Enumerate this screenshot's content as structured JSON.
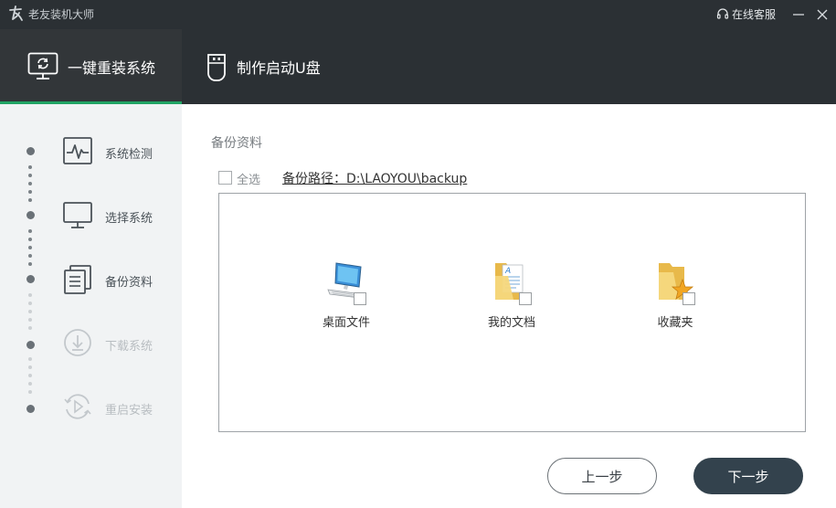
{
  "window": {
    "title": "老友装机大师",
    "service_label": "在线客服"
  },
  "header": {
    "tabs": [
      {
        "label": "一键重装系统",
        "icon": "monitor-refresh-icon",
        "active": true
      },
      {
        "label": "制作启动U盘",
        "icon": "usb-drive-icon",
        "active": false
      }
    ]
  },
  "sidebar": {
    "steps": [
      {
        "label": "系统检测",
        "icon": "pulse-monitor-icon",
        "state": "done"
      },
      {
        "label": "选择系统",
        "icon": "monitor-icon",
        "state": "done"
      },
      {
        "label": "备份资料",
        "icon": "documents-icon",
        "state": "current"
      },
      {
        "label": "下载系统",
        "icon": "download-icon",
        "state": "pending"
      },
      {
        "label": "重启安装",
        "icon": "restart-icon",
        "state": "pending"
      }
    ]
  },
  "main": {
    "section_title": "备份资料",
    "select_all_label": "全选",
    "backup_path": "备份路径：D:\\LAOYOU\\backup",
    "items": [
      {
        "label": "桌面文件",
        "icon": "desktop-computer-icon",
        "checked": false
      },
      {
        "label": "我的文档",
        "icon": "my-documents-folder-icon",
        "checked": false
      },
      {
        "label": "收藏夹",
        "icon": "favorites-folder-icon",
        "checked": false
      }
    ],
    "prev_button": "上一步",
    "next_button": "下一步"
  },
  "colors": {
    "titlebar_bg": "#2b3034",
    "active_tab_underline": "#21a464",
    "sidebar_bg": "#f1f3f4",
    "next_button_bg": "#33424d"
  }
}
